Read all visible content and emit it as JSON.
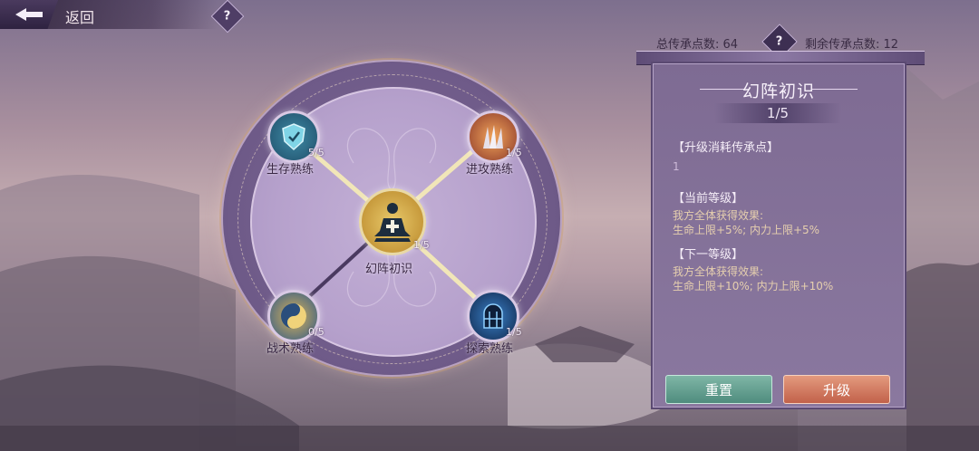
{
  "header": {
    "back_label": "返回",
    "help": "?"
  },
  "points": {
    "total": "总传承点数: 64",
    "remaining": "剩余传承点数: 12",
    "help": "?"
  },
  "wheel": {
    "center": {
      "label": "幻阵初识",
      "count": "1/5",
      "icon": "meditation-plus-icon"
    },
    "nodes": [
      {
        "label": "生存熟练",
        "count": "5/5",
        "icon": "shield-icon"
      },
      {
        "label": "进攻熟练",
        "count": "1/5",
        "icon": "blades-icon"
      },
      {
        "label": "战术熟练",
        "count": "0/5",
        "icon": "yin-yang-icon"
      },
      {
        "label": "探索熟练",
        "count": "1/5",
        "icon": "gate-icon"
      }
    ]
  },
  "panel": {
    "title": "幻阵初识",
    "level": "1/5",
    "cost_heading": "【升级消耗传承点】",
    "cost_value": "1",
    "current_heading": "【当前等级】",
    "current_line1": "我方全体获得效果:",
    "current_line2": "生命上限+5%; 内力上限+5%",
    "next_heading": "【下一等级】",
    "next_line1": "我方全体获得效果:",
    "next_line2": "生命上限+10%; 内力上限+10%",
    "reset_label": "重置",
    "upgrade_label": "升级"
  }
}
